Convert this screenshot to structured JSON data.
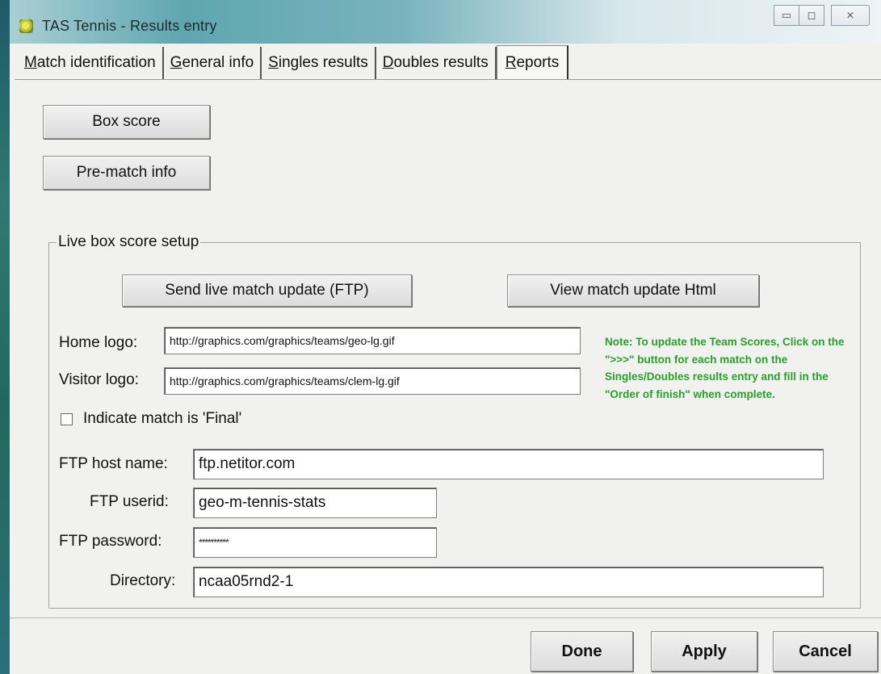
{
  "window": {
    "title": "TAS Tennis - Results entry",
    "controls": {
      "minimize": "▭",
      "maximize": "◻",
      "close": "⨯"
    }
  },
  "tabs": [
    {
      "label": "Match identification",
      "accel": "M",
      "rest": "atch identification"
    },
    {
      "label": "General info",
      "accel": "G",
      "rest": "eneral info"
    },
    {
      "label": "Singles results",
      "accel": "S",
      "rest": "ingles results"
    },
    {
      "label": "Doubles results",
      "accel": "D",
      "rest": "oubles results"
    },
    {
      "label": "Reports",
      "accel": "R",
      "rest": "eports",
      "active": true
    }
  ],
  "reports": {
    "box_score_label": "Box score",
    "pre_match_label": "Pre-match info"
  },
  "live": {
    "group_label": "Live box score setup",
    "send_label": "Send live match update (FTP)",
    "view_label": "View match update Html",
    "home_logo_label": "Home logo:",
    "home_logo_value": "http://graphics.com/graphics/teams/geo-lg.gif",
    "visitor_logo_label": "Visitor logo:",
    "visitor_logo_value": "http://graphics.com/graphics/teams/clem-lg.gif",
    "final_label": "Indicate match is 'Final'",
    "final_checked": false,
    "note": "Note: To update the Team Scores, Click on the \">>>\" button for each match on the Singles/Doubles results entry and fill in the \"Order of finish\" when complete.",
    "ftp_host_label": "FTP host name:",
    "ftp_host_value": "ftp.netitor.com",
    "ftp_userid_label": "FTP userid:",
    "ftp_userid_value": "geo-m-tennis-stats",
    "ftp_password_label": "FTP password:",
    "ftp_password_value": "**********",
    "directory_label": "Directory:",
    "directory_value": "ncaa05rnd2-1"
  },
  "footer": {
    "done_label": "Done",
    "apply_label": "Apply",
    "cancel_label": "Cancel"
  },
  "colors": {
    "note_green": "#2aa02a",
    "titlebar_accent": "#5fa6b0"
  },
  "icons": {
    "app": "app-icon",
    "minimize": "minimize-icon",
    "maximize": "maximize-icon",
    "close": "close-icon"
  }
}
